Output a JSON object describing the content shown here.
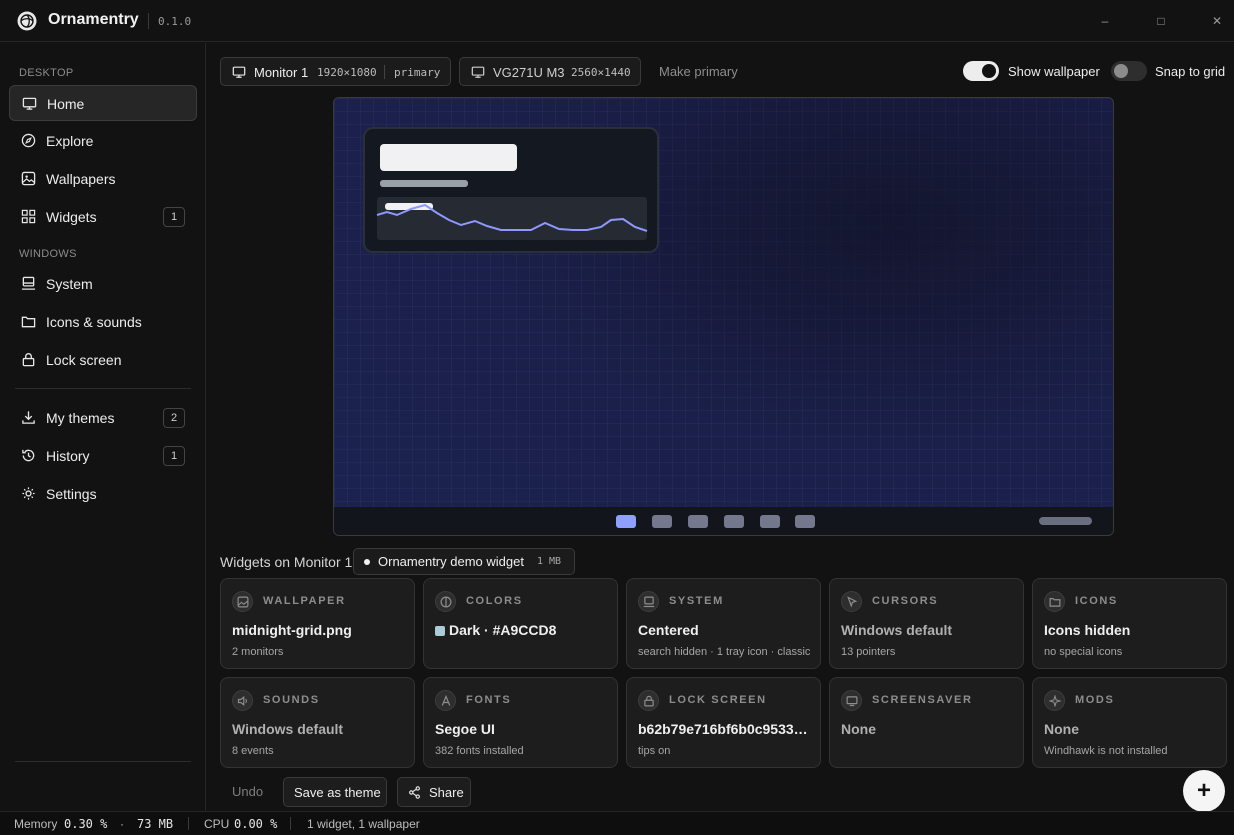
{
  "app": {
    "title": "Ornamentry",
    "version": "0.1.0"
  },
  "window_controls": {
    "minimize": "–",
    "maximize": "□",
    "close": "✕"
  },
  "sidebar": {
    "section_desktop": "DESKTOP",
    "section_windows": "WINDOWS",
    "items": [
      {
        "label": "Home",
        "icon": "monitor-icon",
        "active": true
      },
      {
        "label": "Explore",
        "icon": "compass-icon"
      },
      {
        "label": "Wallpapers",
        "icon": "image-icon"
      },
      {
        "label": "Widgets",
        "icon": "grid-icon",
        "badge": "1"
      },
      {
        "label": "System",
        "icon": "laptop-icon"
      },
      {
        "label": "Icons & sounds",
        "icon": "folder-icon"
      },
      {
        "label": "Lock screen",
        "icon": "lock-icon"
      },
      {
        "label": "My themes",
        "icon": "download-icon",
        "badge": "2"
      },
      {
        "label": "History",
        "icon": "history-icon",
        "badge": "1"
      },
      {
        "label": "Settings",
        "icon": "sun-icon"
      }
    ]
  },
  "monitors": [
    {
      "name": "Monitor 1",
      "resolution": "1920×1080",
      "tag": "primary"
    },
    {
      "name": "VG271U M3",
      "resolution": "2560×1440"
    }
  ],
  "make_primary": "Make primary",
  "toggles": {
    "show_wallpaper": {
      "label": "Show wallpaper",
      "on": true
    },
    "snap_to_grid": {
      "label": "Snap to grid",
      "on": false
    }
  },
  "preview": {
    "taskbar_icons": 6,
    "active_taskbar_icon": 0
  },
  "widgets_row": {
    "label": "Widgets on Monitor 1",
    "chip_name": "Ornamentry demo widget",
    "chip_size": "1 MB"
  },
  "cards": [
    {
      "category": "WALLPAPER",
      "icon": "image-icon",
      "main": "midnight-grid.png",
      "sub": "2 monitors"
    },
    {
      "category": "COLORS",
      "icon": "contrast-icon",
      "main": "Dark · #A9CCD8",
      "sub": "",
      "swatch": "#A9CCD8"
    },
    {
      "category": "SYSTEM",
      "icon": "laptop-icon",
      "main": "Centered",
      "sub": "search hidden · 1 tray icon · classic"
    },
    {
      "category": "CURSORS",
      "icon": "cursor-icon",
      "main": "Windows default",
      "sub": "13 pointers",
      "dim": true
    },
    {
      "category": "ICONS",
      "icon": "folder-icon",
      "main": "Icons hidden",
      "sub": "no special icons"
    },
    {
      "category": "SOUNDS",
      "icon": "speaker-icon",
      "main": "Windows default",
      "sub": "8 events",
      "dim": true
    },
    {
      "category": "FONTS",
      "icon": "font-icon",
      "main": "Segoe UI",
      "sub": "382 fonts installed"
    },
    {
      "category": "LOCK SCREEN",
      "icon": "lock-icon",
      "main": "b62b79e716bf6b0c9533af…",
      "sub": "tips on"
    },
    {
      "category": "SCREENSAVER",
      "icon": "monitor-icon",
      "main": "None",
      "sub": "",
      "dim": true
    },
    {
      "category": "MODS",
      "icon": "sparkle-icon",
      "main": "None",
      "sub": "Windhawk is not installed",
      "dim": true
    }
  ],
  "actions": {
    "undo": "Undo",
    "save_theme": "Save as theme",
    "share": "Share",
    "add": "+"
  },
  "status": {
    "memory_label": "Memory",
    "memory_pct": "0.30 %",
    "dot": "·",
    "memory_mb": "73 MB",
    "cpu_label": "CPU",
    "cpu_pct": "0.00 %",
    "summary": "1 widget, 1 wallpaper"
  },
  "colors": {
    "accent": "#A9CCD8",
    "taskbar_active": "#8EA0FF",
    "background": "#121212"
  }
}
